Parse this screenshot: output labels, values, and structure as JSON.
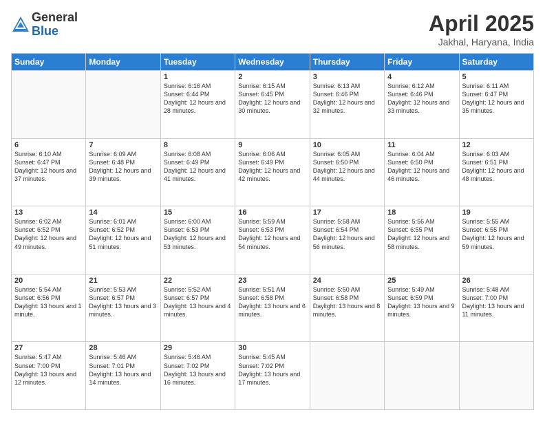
{
  "logo": {
    "general": "General",
    "blue": "Blue"
  },
  "title": "April 2025",
  "location": "Jakhal, Haryana, India",
  "days_header": [
    "Sunday",
    "Monday",
    "Tuesday",
    "Wednesday",
    "Thursday",
    "Friday",
    "Saturday"
  ],
  "weeks": [
    [
      {
        "day": "",
        "sunrise": "",
        "sunset": "",
        "daylight": ""
      },
      {
        "day": "",
        "sunrise": "",
        "sunset": "",
        "daylight": ""
      },
      {
        "day": "1",
        "sunrise": "Sunrise: 6:16 AM",
        "sunset": "Sunset: 6:44 PM",
        "daylight": "Daylight: 12 hours and 28 minutes."
      },
      {
        "day": "2",
        "sunrise": "Sunrise: 6:15 AM",
        "sunset": "Sunset: 6:45 PM",
        "daylight": "Daylight: 12 hours and 30 minutes."
      },
      {
        "day": "3",
        "sunrise": "Sunrise: 6:13 AM",
        "sunset": "Sunset: 6:46 PM",
        "daylight": "Daylight: 12 hours and 32 minutes."
      },
      {
        "day": "4",
        "sunrise": "Sunrise: 6:12 AM",
        "sunset": "Sunset: 6:46 PM",
        "daylight": "Daylight: 12 hours and 33 minutes."
      },
      {
        "day": "5",
        "sunrise": "Sunrise: 6:11 AM",
        "sunset": "Sunset: 6:47 PM",
        "daylight": "Daylight: 12 hours and 35 minutes."
      }
    ],
    [
      {
        "day": "6",
        "sunrise": "Sunrise: 6:10 AM",
        "sunset": "Sunset: 6:47 PM",
        "daylight": "Daylight: 12 hours and 37 minutes."
      },
      {
        "day": "7",
        "sunrise": "Sunrise: 6:09 AM",
        "sunset": "Sunset: 6:48 PM",
        "daylight": "Daylight: 12 hours and 39 minutes."
      },
      {
        "day": "8",
        "sunrise": "Sunrise: 6:08 AM",
        "sunset": "Sunset: 6:49 PM",
        "daylight": "Daylight: 12 hours and 41 minutes."
      },
      {
        "day": "9",
        "sunrise": "Sunrise: 6:06 AM",
        "sunset": "Sunset: 6:49 PM",
        "daylight": "Daylight: 12 hours and 42 minutes."
      },
      {
        "day": "10",
        "sunrise": "Sunrise: 6:05 AM",
        "sunset": "Sunset: 6:50 PM",
        "daylight": "Daylight: 12 hours and 44 minutes."
      },
      {
        "day": "11",
        "sunrise": "Sunrise: 6:04 AM",
        "sunset": "Sunset: 6:50 PM",
        "daylight": "Daylight: 12 hours and 46 minutes."
      },
      {
        "day": "12",
        "sunrise": "Sunrise: 6:03 AM",
        "sunset": "Sunset: 6:51 PM",
        "daylight": "Daylight: 12 hours and 48 minutes."
      }
    ],
    [
      {
        "day": "13",
        "sunrise": "Sunrise: 6:02 AM",
        "sunset": "Sunset: 6:52 PM",
        "daylight": "Daylight: 12 hours and 49 minutes."
      },
      {
        "day": "14",
        "sunrise": "Sunrise: 6:01 AM",
        "sunset": "Sunset: 6:52 PM",
        "daylight": "Daylight: 12 hours and 51 minutes."
      },
      {
        "day": "15",
        "sunrise": "Sunrise: 6:00 AM",
        "sunset": "Sunset: 6:53 PM",
        "daylight": "Daylight: 12 hours and 53 minutes."
      },
      {
        "day": "16",
        "sunrise": "Sunrise: 5:59 AM",
        "sunset": "Sunset: 6:53 PM",
        "daylight": "Daylight: 12 hours and 54 minutes."
      },
      {
        "day": "17",
        "sunrise": "Sunrise: 5:58 AM",
        "sunset": "Sunset: 6:54 PM",
        "daylight": "Daylight: 12 hours and 56 minutes."
      },
      {
        "day": "18",
        "sunrise": "Sunrise: 5:56 AM",
        "sunset": "Sunset: 6:55 PM",
        "daylight": "Daylight: 12 hours and 58 minutes."
      },
      {
        "day": "19",
        "sunrise": "Sunrise: 5:55 AM",
        "sunset": "Sunset: 6:55 PM",
        "daylight": "Daylight: 12 hours and 59 minutes."
      }
    ],
    [
      {
        "day": "20",
        "sunrise": "Sunrise: 5:54 AM",
        "sunset": "Sunset: 6:56 PM",
        "daylight": "Daylight: 13 hours and 1 minute."
      },
      {
        "day": "21",
        "sunrise": "Sunrise: 5:53 AM",
        "sunset": "Sunset: 6:57 PM",
        "daylight": "Daylight: 13 hours and 3 minutes."
      },
      {
        "day": "22",
        "sunrise": "Sunrise: 5:52 AM",
        "sunset": "Sunset: 6:57 PM",
        "daylight": "Daylight: 13 hours and 4 minutes."
      },
      {
        "day": "23",
        "sunrise": "Sunrise: 5:51 AM",
        "sunset": "Sunset: 6:58 PM",
        "daylight": "Daylight: 13 hours and 6 minutes."
      },
      {
        "day": "24",
        "sunrise": "Sunrise: 5:50 AM",
        "sunset": "Sunset: 6:58 PM",
        "daylight": "Daylight: 13 hours and 8 minutes."
      },
      {
        "day": "25",
        "sunrise": "Sunrise: 5:49 AM",
        "sunset": "Sunset: 6:59 PM",
        "daylight": "Daylight: 13 hours and 9 minutes."
      },
      {
        "day": "26",
        "sunrise": "Sunrise: 5:48 AM",
        "sunset": "Sunset: 7:00 PM",
        "daylight": "Daylight: 13 hours and 11 minutes."
      }
    ],
    [
      {
        "day": "27",
        "sunrise": "Sunrise: 5:47 AM",
        "sunset": "Sunset: 7:00 PM",
        "daylight": "Daylight: 13 hours and 12 minutes."
      },
      {
        "day": "28",
        "sunrise": "Sunrise: 5:46 AM",
        "sunset": "Sunset: 7:01 PM",
        "daylight": "Daylight: 13 hours and 14 minutes."
      },
      {
        "day": "29",
        "sunrise": "Sunrise: 5:46 AM",
        "sunset": "Sunset: 7:02 PM",
        "daylight": "Daylight: 13 hours and 16 minutes."
      },
      {
        "day": "30",
        "sunrise": "Sunrise: 5:45 AM",
        "sunset": "Sunset: 7:02 PM",
        "daylight": "Daylight: 13 hours and 17 minutes."
      },
      {
        "day": "",
        "sunrise": "",
        "sunset": "",
        "daylight": ""
      },
      {
        "day": "",
        "sunrise": "",
        "sunset": "",
        "daylight": ""
      },
      {
        "day": "",
        "sunrise": "",
        "sunset": "",
        "daylight": ""
      }
    ]
  ]
}
